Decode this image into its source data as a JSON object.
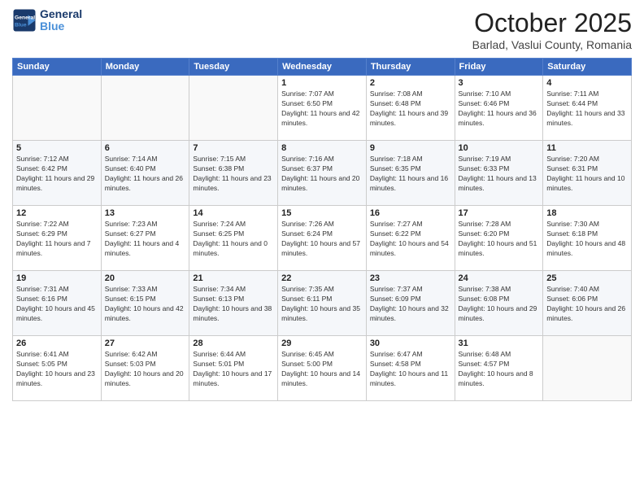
{
  "header": {
    "logo_line1": "General",
    "logo_line2": "Blue",
    "month": "October 2025",
    "location": "Barlad, Vaslui County, Romania"
  },
  "days_of_week": [
    "Sunday",
    "Monday",
    "Tuesday",
    "Wednesday",
    "Thursday",
    "Friday",
    "Saturday"
  ],
  "weeks": [
    [
      {
        "day": "",
        "sunrise": "",
        "sunset": "",
        "daylight": ""
      },
      {
        "day": "",
        "sunrise": "",
        "sunset": "",
        "daylight": ""
      },
      {
        "day": "",
        "sunrise": "",
        "sunset": "",
        "daylight": ""
      },
      {
        "day": "1",
        "sunrise": "7:07 AM",
        "sunset": "6:50 PM",
        "daylight": "11 hours and 42 minutes."
      },
      {
        "day": "2",
        "sunrise": "7:08 AM",
        "sunset": "6:48 PM",
        "daylight": "11 hours and 39 minutes."
      },
      {
        "day": "3",
        "sunrise": "7:10 AM",
        "sunset": "6:46 PM",
        "daylight": "11 hours and 36 minutes."
      },
      {
        "day": "4",
        "sunrise": "7:11 AM",
        "sunset": "6:44 PM",
        "daylight": "11 hours and 33 minutes."
      }
    ],
    [
      {
        "day": "5",
        "sunrise": "7:12 AM",
        "sunset": "6:42 PM",
        "daylight": "11 hours and 29 minutes."
      },
      {
        "day": "6",
        "sunrise": "7:14 AM",
        "sunset": "6:40 PM",
        "daylight": "11 hours and 26 minutes."
      },
      {
        "day": "7",
        "sunrise": "7:15 AM",
        "sunset": "6:38 PM",
        "daylight": "11 hours and 23 minutes."
      },
      {
        "day": "8",
        "sunrise": "7:16 AM",
        "sunset": "6:37 PM",
        "daylight": "11 hours and 20 minutes."
      },
      {
        "day": "9",
        "sunrise": "7:18 AM",
        "sunset": "6:35 PM",
        "daylight": "11 hours and 16 minutes."
      },
      {
        "day": "10",
        "sunrise": "7:19 AM",
        "sunset": "6:33 PM",
        "daylight": "11 hours and 13 minutes."
      },
      {
        "day": "11",
        "sunrise": "7:20 AM",
        "sunset": "6:31 PM",
        "daylight": "11 hours and 10 minutes."
      }
    ],
    [
      {
        "day": "12",
        "sunrise": "7:22 AM",
        "sunset": "6:29 PM",
        "daylight": "11 hours and 7 minutes."
      },
      {
        "day": "13",
        "sunrise": "7:23 AM",
        "sunset": "6:27 PM",
        "daylight": "11 hours and 4 minutes."
      },
      {
        "day": "14",
        "sunrise": "7:24 AM",
        "sunset": "6:25 PM",
        "daylight": "11 hours and 0 minutes."
      },
      {
        "day": "15",
        "sunrise": "7:26 AM",
        "sunset": "6:24 PM",
        "daylight": "10 hours and 57 minutes."
      },
      {
        "day": "16",
        "sunrise": "7:27 AM",
        "sunset": "6:22 PM",
        "daylight": "10 hours and 54 minutes."
      },
      {
        "day": "17",
        "sunrise": "7:28 AM",
        "sunset": "6:20 PM",
        "daylight": "10 hours and 51 minutes."
      },
      {
        "day": "18",
        "sunrise": "7:30 AM",
        "sunset": "6:18 PM",
        "daylight": "10 hours and 48 minutes."
      }
    ],
    [
      {
        "day": "19",
        "sunrise": "7:31 AM",
        "sunset": "6:16 PM",
        "daylight": "10 hours and 45 minutes."
      },
      {
        "day": "20",
        "sunrise": "7:33 AM",
        "sunset": "6:15 PM",
        "daylight": "10 hours and 42 minutes."
      },
      {
        "day": "21",
        "sunrise": "7:34 AM",
        "sunset": "6:13 PM",
        "daylight": "10 hours and 38 minutes."
      },
      {
        "day": "22",
        "sunrise": "7:35 AM",
        "sunset": "6:11 PM",
        "daylight": "10 hours and 35 minutes."
      },
      {
        "day": "23",
        "sunrise": "7:37 AM",
        "sunset": "6:09 PM",
        "daylight": "10 hours and 32 minutes."
      },
      {
        "day": "24",
        "sunrise": "7:38 AM",
        "sunset": "6:08 PM",
        "daylight": "10 hours and 29 minutes."
      },
      {
        "day": "25",
        "sunrise": "7:40 AM",
        "sunset": "6:06 PM",
        "daylight": "10 hours and 26 minutes."
      }
    ],
    [
      {
        "day": "26",
        "sunrise": "6:41 AM",
        "sunset": "5:05 PM",
        "daylight": "10 hours and 23 minutes."
      },
      {
        "day": "27",
        "sunrise": "6:42 AM",
        "sunset": "5:03 PM",
        "daylight": "10 hours and 20 minutes."
      },
      {
        "day": "28",
        "sunrise": "6:44 AM",
        "sunset": "5:01 PM",
        "daylight": "10 hours and 17 minutes."
      },
      {
        "day": "29",
        "sunrise": "6:45 AM",
        "sunset": "5:00 PM",
        "daylight": "10 hours and 14 minutes."
      },
      {
        "day": "30",
        "sunrise": "6:47 AM",
        "sunset": "4:58 PM",
        "daylight": "10 hours and 11 minutes."
      },
      {
        "day": "31",
        "sunrise": "6:48 AM",
        "sunset": "4:57 PM",
        "daylight": "10 hours and 8 minutes."
      },
      {
        "day": "",
        "sunrise": "",
        "sunset": "",
        "daylight": ""
      }
    ]
  ]
}
